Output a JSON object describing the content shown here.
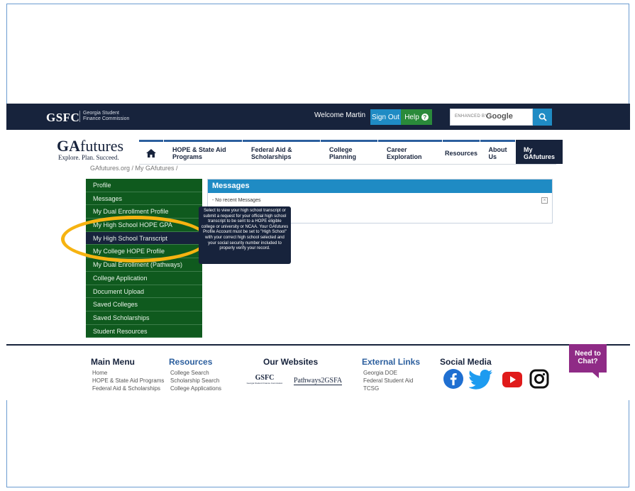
{
  "topbar": {
    "logo": "GSFC",
    "logo_sub_1": "Georgia Student",
    "logo_sub_2": "Finance Commission",
    "welcome": "Welcome Martin",
    "signout": "Sign Out",
    "help": "Help",
    "search_enhanced": "ENHANCED BY",
    "search_google": "Google"
  },
  "brand": {
    "ga": "GA",
    "futures": "futures",
    "tagline": "Explore. Plan. Succeed."
  },
  "nav": {
    "items": [
      "HOPE & State Aid Programs",
      "Federal Aid & Scholarships",
      "College Planning",
      "Career Exploration",
      "Resources",
      "About Us",
      "My GAfutures"
    ]
  },
  "breadcrumb": "GAfutures.org / My GAfutures /",
  "sidebar": {
    "items": [
      "Profile",
      "Messages",
      "My Dual Enrollment Profile",
      "My High School HOPE GPA",
      "My High School Transcript",
      "My College HOPE Profile",
      "My Dual Enrollment (Pathways)",
      "College Application",
      "Document Upload",
      "Saved Colleges",
      "Saved Scholarships",
      "Student Resources"
    ]
  },
  "messages": {
    "title": "Messages",
    "empty": "- No recent Messages"
  },
  "tooltip": "Select to view your high school transcript or submit a request for your official high school transcript to be sent to a HOPE eligible college or university or NCAA. Your GAfutures Profile Account must be set to \"High School\" with your correct high school selected and your social security number included to properly verify your record.",
  "footer": {
    "main_menu": {
      "title": "Main Menu",
      "items": [
        "Home",
        "HOPE & State Aid Programs",
        "Federal Aid & Scholarships"
      ]
    },
    "resources": {
      "title": "Resources",
      "items": [
        "College Search",
        "Scholarship Search",
        "College Applications"
      ]
    },
    "our_websites": {
      "title": "Our Websites",
      "gsfc": "GSFC",
      "gsfc_sub": "Georgia Student Finance Commission",
      "pathways": "Pathways2GSFA"
    },
    "external": {
      "title": "External Links",
      "items": [
        "Georgia DOE",
        "Federal Student Aid",
        "TCSG"
      ]
    },
    "social": {
      "title": "Social Media"
    }
  },
  "chat": {
    "line1": "Need to",
    "line2": "Chat?"
  },
  "colors": {
    "navy": "#17233c",
    "green": "#0f5a1e",
    "blue": "#1f8bc4",
    "highlight": "#f6b311",
    "chat": "#8f2b86"
  }
}
